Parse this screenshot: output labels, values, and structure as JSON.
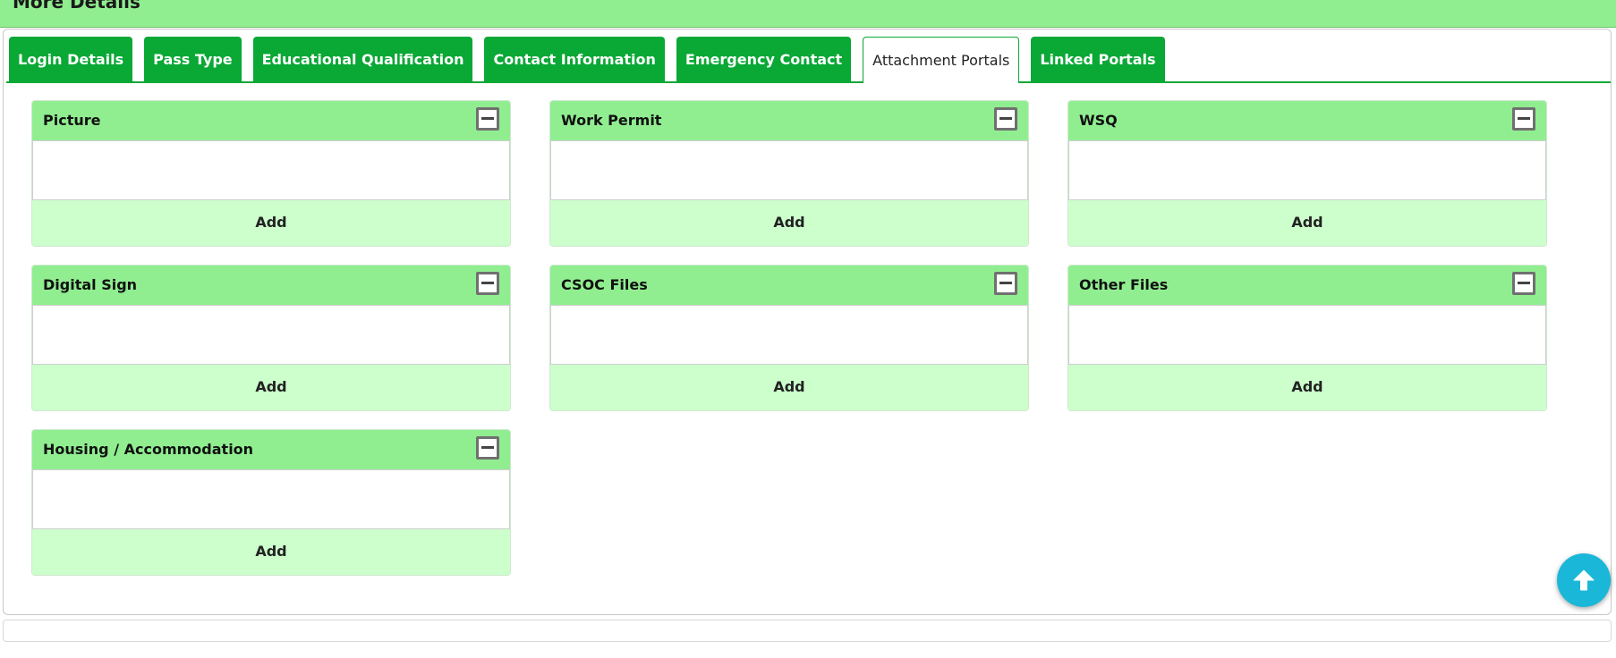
{
  "section": {
    "title": "More Details"
  },
  "tabs": [
    {
      "label": "Login Details"
    },
    {
      "label": "Pass Type"
    },
    {
      "label": "Educational Qualification"
    },
    {
      "label": "Contact Information"
    },
    {
      "label": "Emergency Contact"
    },
    {
      "label": "Attachment Portals",
      "active": true
    },
    {
      "label": "Linked Portals"
    }
  ],
  "cards": [
    {
      "title": "Picture",
      "action": "Add"
    },
    {
      "title": "Work Permit",
      "action": "Add"
    },
    {
      "title": "WSQ",
      "action": "Add"
    },
    {
      "title": "Digital Sign",
      "action": "Add"
    },
    {
      "title": "CSOC Files",
      "action": "Add"
    },
    {
      "title": "Other Files",
      "action": "Add"
    },
    {
      "title": "Housing / Accommodation",
      "action": "Add"
    }
  ],
  "colors": {
    "header_green": "#90ee90",
    "tab_green": "#0aa835",
    "footer_green": "#ccffcc",
    "fab_blue": "#1ab7d8"
  },
  "icons": {
    "collapse": "minus-square-icon",
    "scroll_top": "arrow-up-icon"
  }
}
